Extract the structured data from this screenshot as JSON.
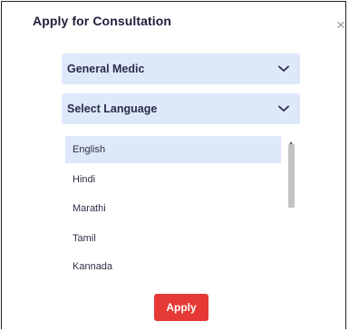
{
  "dialog": {
    "title": "Apply for Consultation",
    "close_icon": "close-icon"
  },
  "specialty_select": {
    "selected": "General Medic",
    "icon": "chevron-down-icon"
  },
  "language_select": {
    "placeholder": "Select Language",
    "icon": "chevron-down-icon",
    "options": [
      "English",
      "Hindi",
      "Marathi",
      "Tamil",
      "Kannada"
    ],
    "highlighted": "English"
  },
  "apply_button": {
    "label": "Apply",
    "color": "#e53935"
  },
  "colors": {
    "select_bg": "#dde9fb",
    "text": "#1e1f3a"
  }
}
